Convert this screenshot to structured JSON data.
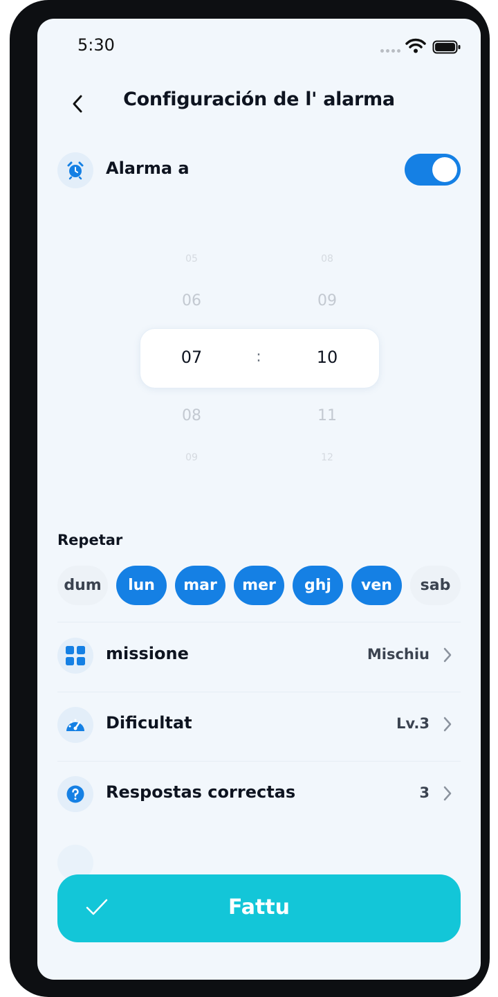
{
  "status_bar": {
    "time": "5:30"
  },
  "header": {
    "title": "Configuración de l' alarma"
  },
  "alarm": {
    "label": "Alarma a",
    "enabled": true
  },
  "time_picker": {
    "hours": {
      "above_far": "05",
      "above_near": "06",
      "selected": "07",
      "below_near": "08",
      "below_far": "09"
    },
    "minutes": {
      "above_far": "08",
      "above_near": "09",
      "selected": "10",
      "below_near": "11",
      "below_far": "12"
    },
    "separator": ":"
  },
  "repeat": {
    "label": "Repetar",
    "days": [
      {
        "label": "dum",
        "selected": false
      },
      {
        "label": "lun",
        "selected": true
      },
      {
        "label": "mar",
        "selected": true
      },
      {
        "label": "mer",
        "selected": true
      },
      {
        "label": "ghj",
        "selected": true
      },
      {
        "label": "ven",
        "selected": true
      },
      {
        "label": "sab",
        "selected": false
      }
    ]
  },
  "settings": [
    {
      "label": "missione",
      "value": "Mischiu",
      "icon": "grid-icon"
    },
    {
      "label": "Dificultat",
      "value": "Lv.3",
      "icon": "gauge-icon"
    },
    {
      "label": "Respostas correctas",
      "value": "3",
      "icon": "question-icon"
    }
  ],
  "done_button": {
    "label": "Fattu"
  },
  "colors": {
    "accent": "#1580e4",
    "done": "#13c6d8",
    "background": "#f2f7fc"
  }
}
